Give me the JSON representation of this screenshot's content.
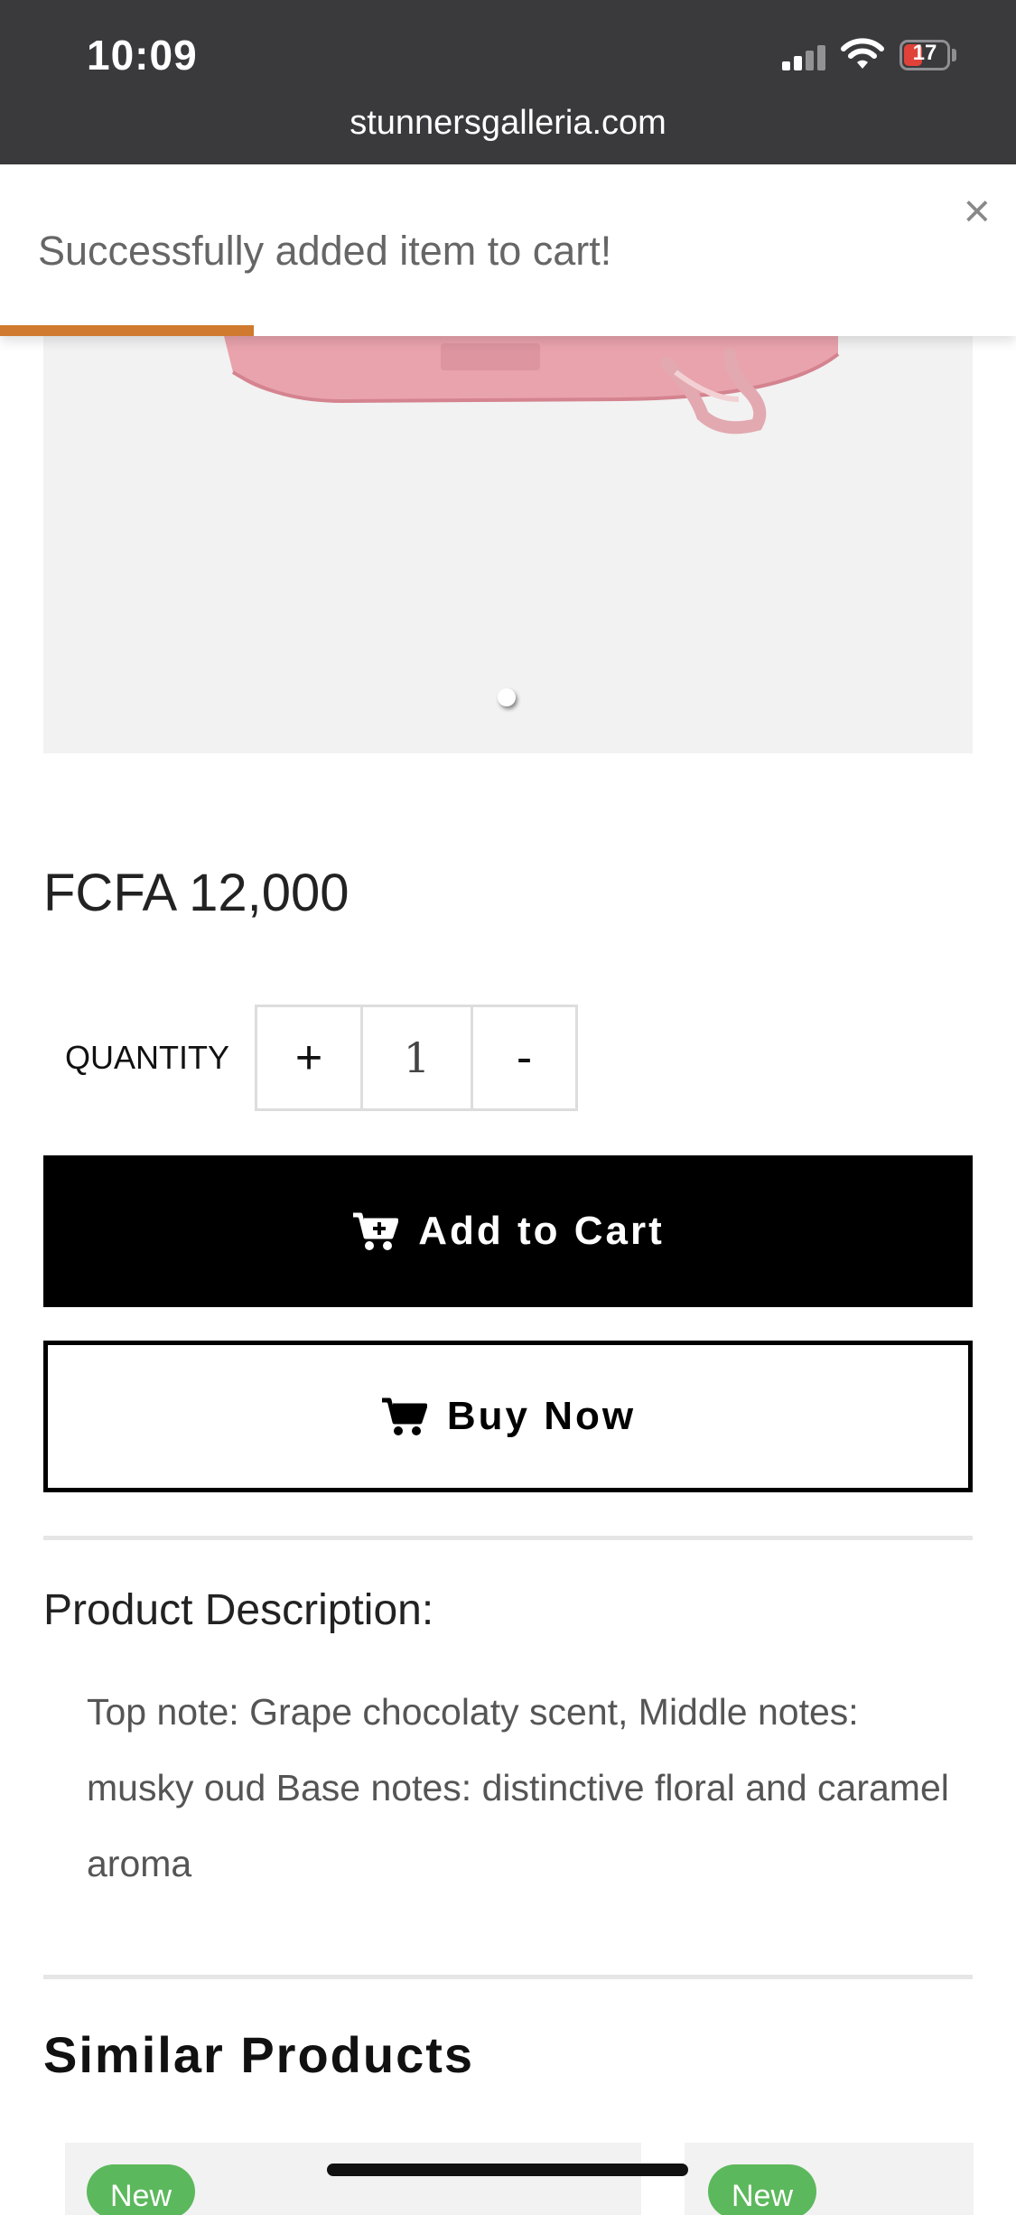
{
  "status_bar": {
    "time": "10:09",
    "battery": "17",
    "battery_color": "#e0423a"
  },
  "browser": {
    "url": "stunnersgalleria.com"
  },
  "toast": {
    "message": "Successfully added item to cart!",
    "close_symbol": "×",
    "progress_color": "#cf7a2e",
    "progress_fraction": 0.25
  },
  "product": {
    "image_icon": "bag-image",
    "gallery_slide_count": 1,
    "price": "FCFA 12,000",
    "quantity_label": "QUANTITY",
    "quantity_plus": "+",
    "quantity_value": "1",
    "quantity_minus": "-",
    "add_to_cart_label": "Add to Cart",
    "add_to_cart_icon": "cart-plus-icon",
    "buy_now_label": "Buy Now",
    "buy_now_icon": "cart-icon",
    "description_title": "Product Description:",
    "description_text": "Top note: Grape chocolaty scent, Middle notes: musky oud Base notes: distinctive floral and caramel aroma"
  },
  "similar": {
    "title": "Similar Products",
    "cards": [
      {
        "badge": "New"
      },
      {
        "badge": "New"
      }
    ],
    "badge_color": "#5cb85c"
  }
}
